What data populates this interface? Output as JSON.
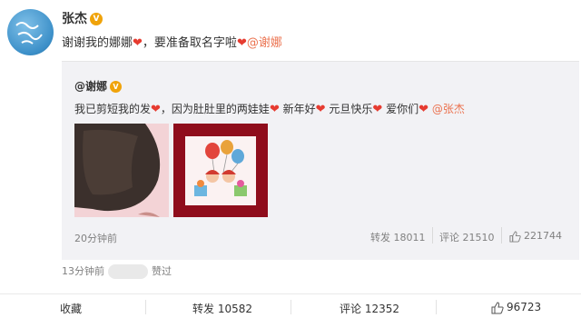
{
  "post": {
    "author": "张杰",
    "verified_badge": "V",
    "text_before": "谢谢我的娜娜",
    "text_middle": "，要准备取名字啦",
    "mention": "@谢娜",
    "heart_icon": "❤"
  },
  "repost": {
    "author": "@谢娜",
    "verified_badge": "V",
    "text_segments": [
      "我已剪短我的发",
      "，因为肚肚里的两娃娃",
      " 新年好",
      " 元旦快乐",
      " 爱你们"
    ],
    "mention": "@张杰",
    "heart_icon": "❤",
    "time": "20分钟前",
    "repost_label": "转发 18011",
    "comment_label": "评论 21510",
    "like_count": "221744",
    "accent_color": "#eb7350"
  },
  "meta": {
    "time": "13分钟前",
    "liked": "赞过"
  },
  "footer": {
    "favorite": "收藏",
    "repost": "转发 10582",
    "comment": "评论 12352",
    "like_count": "96723"
  }
}
